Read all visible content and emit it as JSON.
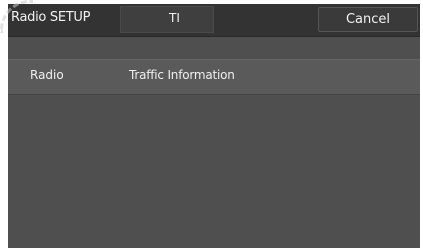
{
  "header": {
    "title": "Radio SETUP",
    "tab_label": "TI",
    "cancel_label": "Cancel"
  },
  "settings": {
    "row": {
      "label": "Radio",
      "value": "Traffic Information"
    }
  },
  "colors": {
    "screen_background": "#4f4f4f",
    "header_background": "#333333",
    "row_background": "#5a5a5a",
    "text": "#f2f2f2"
  }
}
